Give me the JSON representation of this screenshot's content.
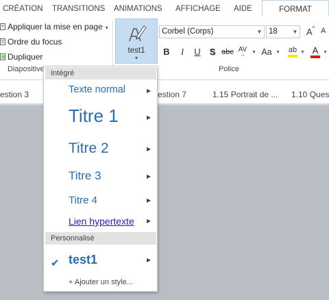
{
  "tabs": [
    {
      "label": "CRÉATION"
    },
    {
      "label": "TRANSITIONS"
    },
    {
      "label": "ANIMATIONS"
    },
    {
      "label": "AFFICHAGE"
    },
    {
      "label": "AIDE"
    },
    {
      "label": "FORMAT"
    }
  ],
  "ribbon": {
    "diapositives": {
      "items": [
        "Appliquer la mise en page",
        "Ordre du focus",
        "Dupliquer"
      ],
      "group_label": "Diapositive"
    },
    "style_button": {
      "label": "test1"
    },
    "police": {
      "font_name": "Corbel (Corps)",
      "font_size": "18",
      "grow": "A",
      "shrink": "A",
      "bold": "B",
      "italic": "I",
      "underline": "U",
      "shadow": "S",
      "strikethrough": "abc",
      "spacing": "AV",
      "change_case": "Aa",
      "highlight": "ab",
      "font_color": "A",
      "group_label": "Police",
      "colors": {
        "highlight": "#f2e600",
        "font_color": "#d81a1a"
      }
    }
  },
  "slide_tabs": [
    "estion 3",
    "estion 7",
    "1.15 Portrait de ...",
    "1.10 Ques"
  ],
  "menu": {
    "builtin_header": "Intégré",
    "styles": [
      {
        "label": "Texte normal"
      },
      {
        "label": "Titre 1"
      },
      {
        "label": "Titre 2"
      },
      {
        "label": "Titre 3"
      },
      {
        "label": "Titre 4"
      },
      {
        "label": "Lien hypertexte"
      }
    ],
    "custom_header": "Personnalisé",
    "custom_styles": [
      {
        "label": "test1",
        "selected": true
      }
    ],
    "add_style": "+ Ajouter un style..."
  },
  "colors": {
    "accent": "#2b6cb1",
    "selected_button": "#c5dcf2",
    "background": "#b9bec5"
  }
}
